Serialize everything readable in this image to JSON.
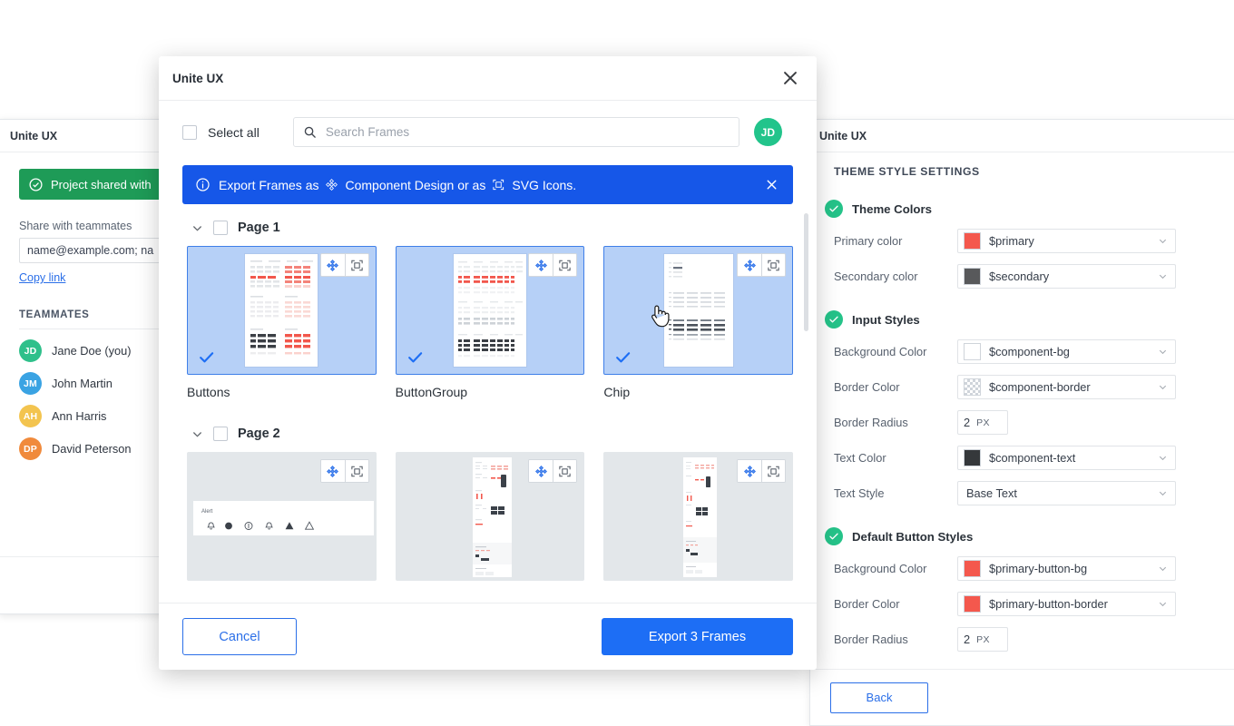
{
  "left_panel": {
    "header_title": "Unite UX",
    "toast": {
      "icon": "check-circle-icon",
      "text": "Project shared with",
      "bg": "#1e9b57"
    },
    "share_label": "Share with teammates",
    "email_input_value": "name@example.com; na",
    "copy_link": "Copy link",
    "teammates_title": "TEAMMATES",
    "teammates": [
      {
        "initials": "JD",
        "name": "Jane Doe (you)",
        "color": "#2fc08b"
      },
      {
        "initials": "JM",
        "name": "John Martin",
        "color": "#3aa3e3"
      },
      {
        "initials": "AH",
        "name": "Ann Harris",
        "color": "#f3c44f"
      },
      {
        "initials": "DP",
        "name": "David Peterson",
        "color": "#f08a3c"
      }
    ]
  },
  "right_panel": {
    "header_title": "Unite UX",
    "section_title": "THEME STYLE SETTINGS",
    "groups": [
      {
        "name": "Theme Colors",
        "rows": [
          {
            "label": "Primary color",
            "type": "select",
            "swatch": "#f4584d",
            "value": "$primary"
          },
          {
            "label": "Secondary color",
            "type": "select",
            "swatch": "#58595b",
            "value": "$secondary"
          }
        ]
      },
      {
        "name": "Input Styles",
        "rows": [
          {
            "label": "Background Color",
            "type": "select",
            "swatch": "#ffffff",
            "value": "$component-bg"
          },
          {
            "label": "Border Color",
            "type": "select",
            "swatch": "checker",
            "value": "$component-border"
          },
          {
            "label": "Border Radius",
            "type": "stepper",
            "value": "2",
            "unit": "PX"
          },
          {
            "label": "Text Color",
            "type": "select",
            "swatch": "#35383b",
            "value": "$component-text"
          },
          {
            "label": "Text Style",
            "type": "select",
            "swatch": null,
            "value": "Base Text"
          }
        ]
      },
      {
        "name": "Default Button Styles",
        "rows": [
          {
            "label": "Background Color",
            "type": "select",
            "swatch": "#f4584d",
            "value": "$primary-button-bg"
          },
          {
            "label": "Border Color",
            "type": "select",
            "swatch": "#f4584d",
            "value": "$primary-button-border"
          },
          {
            "label": "Border Radius",
            "type": "stepper",
            "value": "2",
            "unit": "PX"
          }
        ]
      }
    ],
    "back_button": "Back"
  },
  "modal": {
    "title": "Unite UX",
    "close_icon": "close-icon",
    "select_all_label": "Select all",
    "search_placeholder": "Search Frames",
    "user_avatar_initials": "JD",
    "banner": {
      "info_icon": "info-icon",
      "prefix": "Export Frames as",
      "component_icon": "component-design-icon",
      "component_label": "Component Design or as",
      "svg_icon": "svg-frame-icon",
      "svg_label": "SVG Icons.",
      "close_icon": "close-icon",
      "bg": "#1657e8"
    },
    "pages": [
      {
        "name": "Page 1",
        "cards": [
          {
            "name": "Buttons",
            "selected": true,
            "thumb": "buttons-wireframe"
          },
          {
            "name": "ButtonGroup",
            "selected": true,
            "thumb": "buttongroup-wireframe"
          },
          {
            "name": "Chip",
            "selected": true,
            "thumb": "chip-wireframe"
          }
        ]
      },
      {
        "name": "Page 2",
        "cards": [
          {
            "name": "",
            "selected": false,
            "thumb": "alert-wireframe"
          },
          {
            "name": "",
            "selected": false,
            "thumb": "form-wireframe"
          },
          {
            "name": "",
            "selected": false,
            "thumb": "table-wireframe"
          }
        ]
      }
    ],
    "card_tools": {
      "component": "component-design-icon",
      "svg": "svg-frame-icon"
    },
    "cancel_label": "Cancel",
    "export_label": "Export 3 Frames"
  }
}
